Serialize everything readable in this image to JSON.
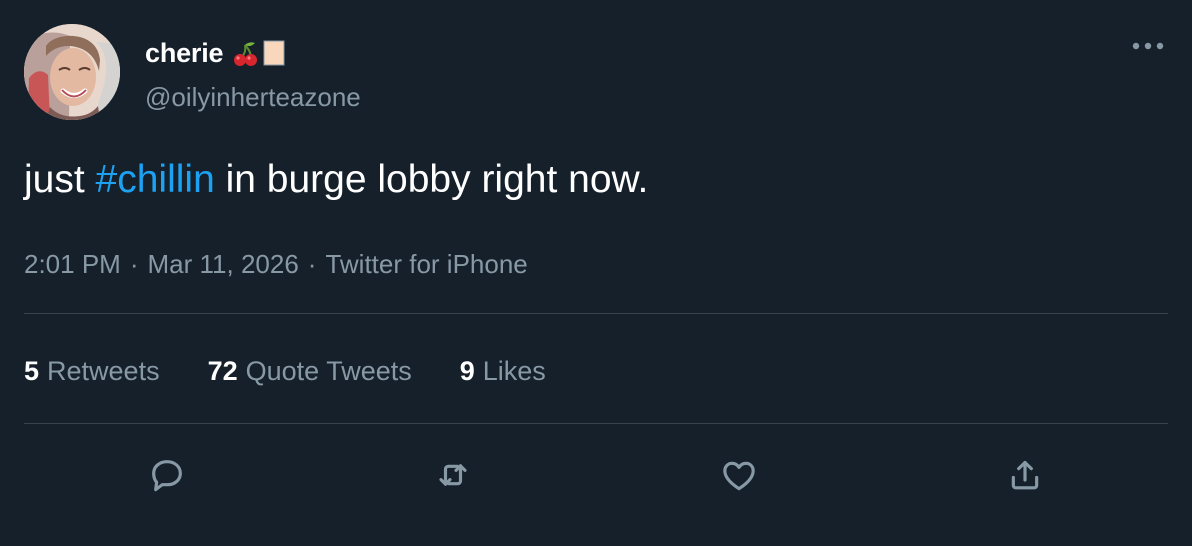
{
  "tweet": {
    "author": {
      "display_name": "cherie",
      "emoji": [
        "cherry-icon",
        "tofu-icon"
      ],
      "handle": "@oilyinherteazone"
    },
    "text_before": "just ",
    "hashtag": "#chillin",
    "text_after": " in burge lobby right now.",
    "time": "2:01 PM",
    "date": "Mar 11, 2026",
    "source": "Twitter for iPhone",
    "separator": "·",
    "stats": {
      "retweets_count": "5",
      "retweets_label": "Retweets",
      "quote_tweets_count": "72",
      "quote_tweets_label": "Quote Tweets",
      "likes_count": "9",
      "likes_label": "Likes"
    },
    "actions": [
      "reply-icon",
      "retweet-icon",
      "like-icon",
      "share-icon"
    ],
    "colors": {
      "background": "#15202b",
      "text": "#ffffff",
      "secondary_text": "#8899a6",
      "accent": "#1da1f2",
      "divider": "#38444d"
    }
  }
}
